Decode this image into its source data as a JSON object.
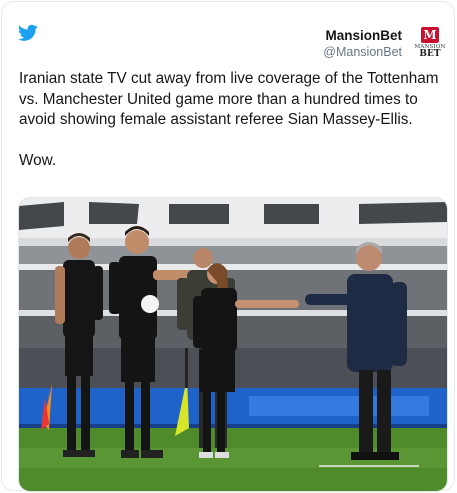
{
  "header": {
    "display_name": "MansionBet",
    "handle": "@MansionBet",
    "avatar_logo": {
      "mark": "M",
      "line1": "MANSION",
      "line2": "BET"
    }
  },
  "tweet": {
    "paragraphs": [
      "Iranian state TV cut away from live coverage of the Tottenham vs. Manchester United game more than a hundred times to avoid showing female assistant referee Sian Massey-Ellis.",
      "Wow."
    ]
  },
  "colors": {
    "twitter_blue": "#1da1f2",
    "pitch_green": "#4f8a2b",
    "ad_board_blue": "#1f62c9"
  }
}
